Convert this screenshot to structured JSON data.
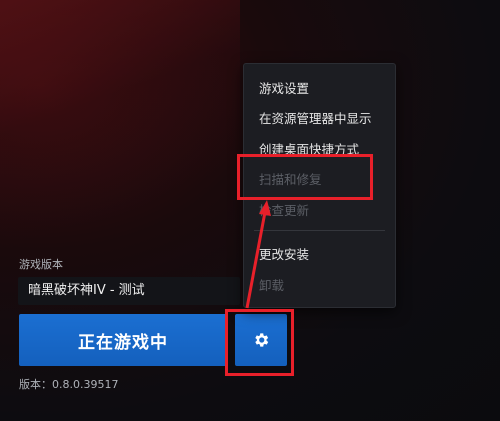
{
  "game_version_label": "游戏版本",
  "selected_game": "暗黑破坏神IV - 测试",
  "play_button_label": "正在游戏中",
  "version_text": "版本：0.8.0.39517",
  "settings_icon": "gear-icon",
  "menu": {
    "items": [
      {
        "label": "游戏设置",
        "enabled": true
      },
      {
        "label": "在资源管理器中显示",
        "enabled": true
      },
      {
        "label": "创建桌面快捷方式",
        "enabled": true
      },
      {
        "label": "扫描和修复",
        "enabled": false
      },
      {
        "label": "检查更新",
        "enabled": false
      },
      {
        "label": "更改安装",
        "enabled": true
      },
      {
        "label": "卸载",
        "enabled": false
      }
    ]
  },
  "colors": {
    "accent_blue": "#1b6fd2",
    "highlight_red": "#e8202a",
    "menu_bg": "#1c1d22"
  }
}
